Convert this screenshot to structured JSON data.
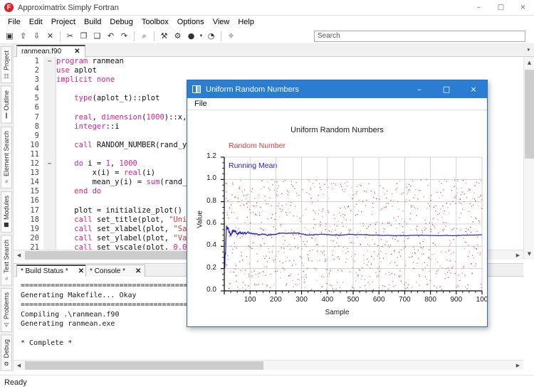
{
  "window": {
    "app_title": "Approximatrix Simply Fortran",
    "logo_glyph": "F",
    "minimize": "–",
    "maximize": "□",
    "close": "×"
  },
  "menubar": {
    "items": [
      "File",
      "Edit",
      "Project",
      "Build",
      "Debug",
      "Toolbox",
      "Options",
      "View",
      "Help"
    ]
  },
  "toolbar": {
    "icons": [
      {
        "name": "new-file-icon",
        "glyph": "▣"
      },
      {
        "name": "open-file-icon",
        "glyph": "⇧"
      },
      {
        "name": "save-file-icon",
        "glyph": "⇩"
      },
      {
        "name": "close-file-icon",
        "glyph": "✕"
      },
      {
        "name": "cut-icon",
        "glyph": "✂"
      },
      {
        "name": "copy-icon",
        "glyph": "❐"
      },
      {
        "name": "paste-icon",
        "glyph": "❑"
      },
      {
        "name": "undo-icon",
        "glyph": "↶"
      },
      {
        "name": "redo-icon",
        "glyph": "↷"
      },
      {
        "name": "find-icon",
        "glyph": "⌕"
      },
      {
        "name": "clean-icon",
        "glyph": "⚒"
      },
      {
        "name": "build-icon",
        "glyph": "⚙"
      },
      {
        "name": "run-icon",
        "glyph": "●"
      },
      {
        "name": "debug-icon",
        "glyph": "◔"
      },
      {
        "name": "stop-icon",
        "glyph": "✧"
      }
    ]
  },
  "search": {
    "placeholder": "Search",
    "value": ""
  },
  "sidebar": {
    "items": [
      {
        "label": "Project",
        "icon": "☷"
      },
      {
        "label": "Outline",
        "icon": "‖"
      },
      {
        "label": "Element Search",
        "icon": "⌕"
      },
      {
        "label": "Modules",
        "icon": "■"
      },
      {
        "label": "Text Search",
        "icon": "⌕"
      },
      {
        "label": "Problems",
        "icon": "⚠"
      },
      {
        "label": "Debug",
        "icon": "⚙"
      }
    ]
  },
  "editor": {
    "tab": {
      "label": "ranmean.f90",
      "close": "✕"
    },
    "overflow_caret": "▾",
    "lines": [
      {
        "n": 1,
        "fold": "−",
        "html": "<span class=\"kw\">program</span> ranmean"
      },
      {
        "n": 2,
        "fold": "",
        "html": "<span class=\"kw\">use</span> aplot"
      },
      {
        "n": 3,
        "fold": "",
        "html": "<span class=\"kw\">implicit none</span>"
      },
      {
        "n": 4,
        "fold": "",
        "html": ""
      },
      {
        "n": 5,
        "fold": "",
        "html": "    <span class=\"kw\">type</span>(aplot_t)::plot"
      },
      {
        "n": 6,
        "fold": "",
        "html": ""
      },
      {
        "n": 7,
        "fold": "",
        "html": "    <span class=\"kw\">real</span>, <span class=\"kw\">dimension</span>(<span class=\"num\">1000</span>)::x,"
      },
      {
        "n": 8,
        "fold": "",
        "html": "    <span class=\"kw\">integer</span>::i"
      },
      {
        "n": 9,
        "fold": "",
        "html": ""
      },
      {
        "n": 10,
        "fold": "",
        "html": "    <span class=\"kw\">call</span> RANDOM_NUMBER(rand_y"
      },
      {
        "n": 11,
        "fold": "",
        "html": ""
      },
      {
        "n": 12,
        "fold": "−",
        "html": "    <span class=\"kw\">do</span> i = <span class=\"num\">1</span>, <span class=\"num\">1000</span>"
      },
      {
        "n": 13,
        "fold": "",
        "html": "        x(i) = <span class=\"kw\">real</span>(i)"
      },
      {
        "n": 14,
        "fold": "",
        "html": "        mean_y(i) = <span class=\"kw\">sum</span>(rand_"
      },
      {
        "n": 15,
        "fold": "",
        "html": "    <span class=\"kw\">end do</span>"
      },
      {
        "n": 16,
        "fold": "",
        "html": ""
      },
      {
        "n": 17,
        "fold": "",
        "html": "    plot = initialize_plot()"
      },
      {
        "n": 18,
        "fold": "",
        "html": "    <span class=\"kw\">call</span> set_title(plot, <span class=\"str\">\"Uni</span>"
      },
      {
        "n": 19,
        "fold": "",
        "html": "    <span class=\"kw\">call</span> set_xlabel(plot, <span class=\"str\">\"Sa</span>"
      },
      {
        "n": 20,
        "fold": "",
        "html": "    <span class=\"kw\">call</span> set_ylabel(plot, <span class=\"str\">\"Va</span>"
      },
      {
        "n": 21,
        "fold": "",
        "html": "    <span class=\"kw\">call</span> set_yscale(plot, <span class=\"num\">0.0</span>"
      }
    ]
  },
  "bottom_panel": {
    "tabs": [
      {
        "label": "* Build Status *",
        "close": "✕",
        "active": true
      },
      {
        "label": "* Console *",
        "close": "✕",
        "active": false
      }
    ],
    "output": "==========================================\nGenerating Makefile... Okay\n==========================================\nCompiling .\\ranmean.f90\nGenerating ranmean.exe\n\n* Complete *"
  },
  "statusbar": {
    "text": "Ready"
  },
  "plot_window": {
    "title": "Uniform Random Numbers",
    "minimize": "–",
    "maximize": "□",
    "close": "×",
    "menu": [
      "File"
    ]
  },
  "chart_data": {
    "type": "scatter",
    "title": "Uniform Random Numbers",
    "xlabel": "Sample",
    "ylabel": "Value",
    "xlim": [
      0,
      1000
    ],
    "ylim": [
      0.0,
      1.2
    ],
    "xticks": [
      0,
      100,
      200,
      300,
      400,
      500,
      600,
      700,
      800,
      900,
      1000
    ],
    "xtick_labels": [
      "",
      "100",
      "200",
      "300",
      "400",
      "500",
      "600",
      "700",
      "800",
      "900",
      "100"
    ],
    "yticks": [
      0.0,
      0.2,
      0.4,
      0.6,
      0.8,
      1.0,
      1.2
    ],
    "ytick_labels": [
      "0.0",
      "0.2",
      "0.4",
      "0.6",
      "0.8",
      "1.0",
      "1.2"
    ],
    "grid": true,
    "legend_position": "upper-left-inside",
    "series": [
      {
        "name": "Random Number",
        "type": "scatter",
        "color": "#e23b3b",
        "n_points": 1000,
        "distribution": "uniform(0,1)",
        "description": "1000 uniform random samples scattered between 0.0 and 1.0"
      },
      {
        "name": "Running Mean",
        "type": "line",
        "color": "#2222cc",
        "n_points": 1000,
        "converges_to": 0.5,
        "description": "Cumulative running mean, oscillates near start then converges to ~0.50",
        "sample_values": [
          {
            "x": 1,
            "y": 0.4
          },
          {
            "x": 5,
            "y": 0.55
          },
          {
            "x": 10,
            "y": 0.46
          },
          {
            "x": 20,
            "y": 0.53
          },
          {
            "x": 30,
            "y": 0.49
          },
          {
            "x": 50,
            "y": 0.52
          },
          {
            "x": 75,
            "y": 0.52
          },
          {
            "x": 100,
            "y": 0.5
          },
          {
            "x": 150,
            "y": 0.497
          },
          {
            "x": 200,
            "y": 0.505
          },
          {
            "x": 300,
            "y": 0.503
          },
          {
            "x": 400,
            "y": 0.502
          },
          {
            "x": 500,
            "y": 0.504
          },
          {
            "x": 600,
            "y": 0.499
          },
          {
            "x": 700,
            "y": 0.5
          },
          {
            "x": 800,
            "y": 0.5
          },
          {
            "x": 900,
            "y": 0.499
          },
          {
            "x": 1000,
            "y": 0.499
          }
        ]
      }
    ]
  }
}
